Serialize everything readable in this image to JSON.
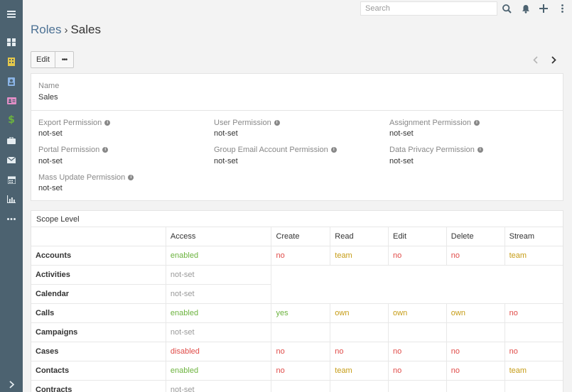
{
  "topbar": {
    "search_placeholder": "Search"
  },
  "sidebar": {
    "items": [
      {
        "name": "dashboard-icon",
        "color": "#e6edf1"
      },
      {
        "name": "building-icon",
        "color": "#e5c84a"
      },
      {
        "name": "contact-book-icon",
        "color": "#8ab4e6"
      },
      {
        "name": "id-card-icon",
        "color": "#e18ec6"
      },
      {
        "name": "dollar-icon",
        "color": "#6cb33e"
      },
      {
        "name": "briefcase-icon",
        "color": "#e6edf1"
      },
      {
        "name": "envelope-icon",
        "color": "#e6edf1"
      },
      {
        "name": "calendar-icon",
        "color": "#e6edf1"
      },
      {
        "name": "bar-chart-icon",
        "color": "#e6edf1"
      },
      {
        "name": "more-icon",
        "color": "#e6edf1"
      }
    ]
  },
  "breadcrumb": {
    "root": "Roles",
    "separator": "›",
    "current": "Sales"
  },
  "actions": {
    "edit_label": "Edit",
    "more_label": "•••"
  },
  "overview": {
    "name_label": "Name",
    "name_value": "Sales",
    "fields": [
      {
        "label": "Export Permission",
        "value": "not-set"
      },
      {
        "label": "User Permission",
        "value": "not-set"
      },
      {
        "label": "Assignment Permission",
        "value": "not-set"
      },
      {
        "label": "Portal Permission",
        "value": "not-set"
      },
      {
        "label": "Group Email Account Permission",
        "value": "not-set"
      },
      {
        "label": "Data Privacy Permission",
        "value": "not-set"
      },
      {
        "label": "Mass Update Permission",
        "value": "not-set"
      }
    ]
  },
  "scope": {
    "title": "Scope Level",
    "columns": [
      "",
      "Access",
      "Create",
      "Read",
      "Edit",
      "Delete",
      "Stream"
    ],
    "rows": [
      {
        "name": "Accounts",
        "cells": [
          "enabled",
          "no",
          "team",
          "no",
          "no",
          "team"
        ]
      },
      {
        "name": "Activities",
        "cells": [
          "not-set"
        ]
      },
      {
        "name": "Calendar",
        "cells": [
          "not-set"
        ]
      },
      {
        "name": "Calls",
        "cells": [
          "enabled",
          "yes",
          "own",
          "own",
          "own",
          "no"
        ]
      },
      {
        "name": "Campaigns",
        "cells": [
          "not-set",
          "",
          "",
          "",
          "",
          ""
        ]
      },
      {
        "name": "Cases",
        "cells": [
          "disabled",
          "no",
          "no",
          "no",
          "no",
          "no"
        ]
      },
      {
        "name": "Contacts",
        "cells": [
          "enabled",
          "no",
          "team",
          "no",
          "no",
          "team"
        ]
      },
      {
        "name": "Contracts",
        "cells": [
          "not-set",
          "",
          "",
          "",
          "",
          ""
        ]
      }
    ]
  },
  "colors": {
    "sidebar_bg": "#4c6270",
    "link": "#4c7194",
    "enabled": "#6cb33e",
    "disabled": "#e04b48",
    "level": "#c69c16",
    "not_set": "#999999"
  }
}
